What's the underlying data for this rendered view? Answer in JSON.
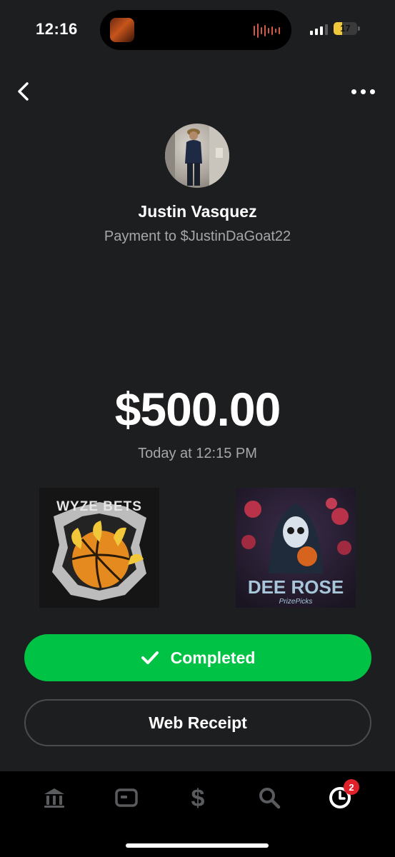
{
  "status_bar": {
    "time": "12:16",
    "battery_percent": "17",
    "battery_level": 0.17
  },
  "recipient": {
    "name": "Justin Vasquez",
    "subtitle": "Payment to $JustinDaGoat22"
  },
  "payment": {
    "amount": "$500.00",
    "date": "Today at 12:15 PM"
  },
  "images": {
    "left_logo_text": "WYZE BETS",
    "right_logo_text": "DEE ROSE",
    "right_logo_sub": "PrizePicks"
  },
  "actions": {
    "completed_label": "Completed",
    "receipt_label": "Web Receipt"
  },
  "tabbar": {
    "items": [
      "bank-icon",
      "card-icon",
      "dollar-icon",
      "search-icon",
      "activity-icon"
    ],
    "activity_badge": "2"
  },
  "colors": {
    "background": "#1d1e20",
    "accent_green": "#00c244",
    "badge_red": "#e0202a"
  }
}
